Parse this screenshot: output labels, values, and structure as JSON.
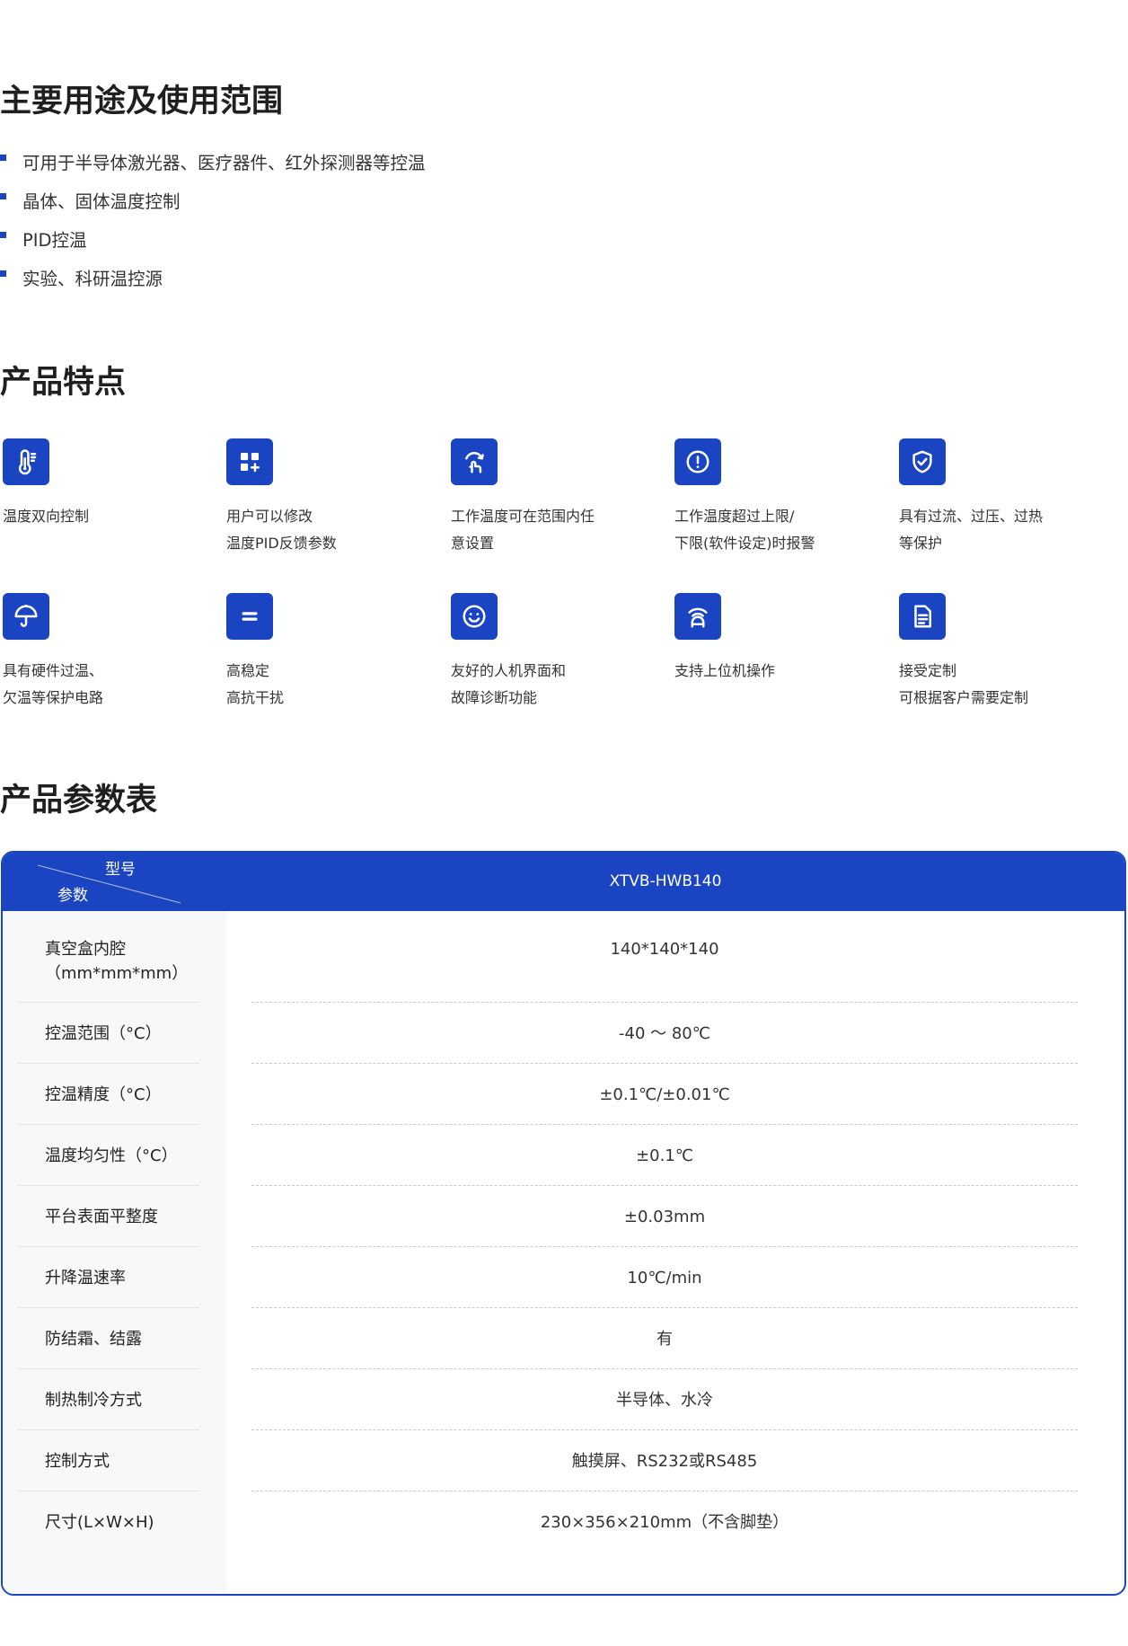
{
  "colors": {
    "accent": "#1b44c2",
    "heading": "#1f1f1f",
    "text": "#333333",
    "param_label_bg": "#f7f8fa"
  },
  "usage": {
    "title": "主要用途及使用范围",
    "items": [
      "可用于半导体激光器、医疗器件、红外探测器等控温",
      "晶体、固体温度控制",
      "PID控温",
      "实验、科研温控源"
    ]
  },
  "features": {
    "title": "产品特点",
    "items": [
      {
        "icon": "thermometer-icon",
        "lines": [
          "温度双向控制"
        ]
      },
      {
        "icon": "grid-plus-icon",
        "lines": [
          "用户可以修改",
          "温度PID反馈参数"
        ]
      },
      {
        "icon": "hand-gesture-icon",
        "lines": [
          "工作温度可在范围内任",
          "意设置"
        ]
      },
      {
        "icon": "alert-circle-icon",
        "lines": [
          "工作温度超过上限/",
          "下限(软件设定)时报警"
        ]
      },
      {
        "icon": "shield-check-icon",
        "lines": [
          "具有过流、过压、过热",
          "等保护"
        ]
      },
      {
        "icon": "umbrella-icon",
        "lines": [
          "具有硬件过温、",
          "欠温等保护电路"
        ]
      },
      {
        "icon": "equals-icon",
        "lines": [
          "高稳定",
          "高抗干扰"
        ]
      },
      {
        "icon": "smile-icon",
        "lines": [
          "友好的人机界面和",
          "故障诊断功能"
        ]
      },
      {
        "icon": "wireless-device-icon",
        "lines": [
          "支持上位机操作"
        ]
      },
      {
        "icon": "document-icon",
        "lines": [
          "接受定制",
          "可根据客户需要定制"
        ]
      }
    ]
  },
  "params": {
    "title": "产品参数表",
    "header": {
      "model_label": "型号",
      "param_label": "参数",
      "model": "XTVB-HWB140"
    },
    "rows": [
      {
        "label": [
          "真空盒内腔",
          "（mm*mm*mm）"
        ],
        "value": "140*140*140"
      },
      {
        "label": [
          "控温范围（°C）"
        ],
        "value": "-40 ～ 80℃"
      },
      {
        "label": [
          "控温精度（°C）"
        ],
        "value": "±0.1℃/±0.01℃"
      },
      {
        "label": [
          "温度均匀性（°C）"
        ],
        "value": "±0.1℃"
      },
      {
        "label": [
          "平台表面平整度"
        ],
        "value": "±0.03mm"
      },
      {
        "label": [
          "升降温速率"
        ],
        "value": "10℃/min"
      },
      {
        "label": [
          "防结霜、结露"
        ],
        "value": "有"
      },
      {
        "label": [
          "制热制冷方式"
        ],
        "value": "半导体、水冷"
      },
      {
        "label": [
          "控制方式"
        ],
        "value": "触摸屏、RS232或RS485"
      },
      {
        "label": [
          "尺寸(L×W×H)"
        ],
        "value": "230×356×210mm（不含脚垫）"
      }
    ]
  }
}
